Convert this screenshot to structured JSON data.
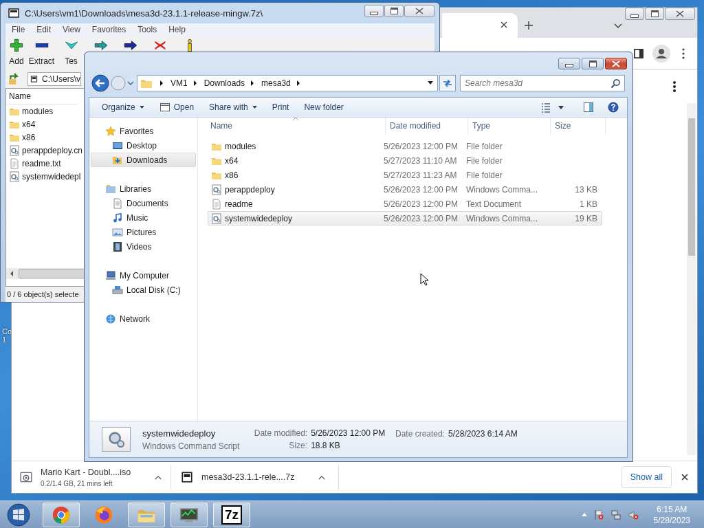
{
  "desktop": {
    "icon_label_lines": [
      "Co",
      "1"
    ]
  },
  "archive_window": {
    "title": "C:\\Users\\vm1\\Downloads\\mesa3d-23.1.1-release-mingw.7z\\",
    "menu": [
      "File",
      "Edit",
      "View",
      "Favorites",
      "Tools",
      "Help"
    ],
    "toolbar": [
      {
        "kind": "add",
        "label": "Add"
      },
      {
        "kind": "extract",
        "label": "Extract"
      },
      {
        "kind": "test",
        "label": "Tes"
      },
      {
        "kind": "copy"
      },
      {
        "kind": "move"
      },
      {
        "kind": "delete"
      },
      {
        "kind": "info"
      }
    ],
    "address": "C:\\Users\\v",
    "column": "Name",
    "files": [
      {
        "name": "modules",
        "kind": "folder"
      },
      {
        "name": "x64",
        "kind": "folder"
      },
      {
        "name": "x86",
        "kind": "folder"
      },
      {
        "name": "perappdeploy.cn",
        "kind": "script"
      },
      {
        "name": "readme.txt",
        "kind": "text"
      },
      {
        "name": "systemwidedepl",
        "kind": "script"
      }
    ],
    "status": "0 / 6 object(s) selecte"
  },
  "browser": {
    "downloads": [
      {
        "kind": "iso",
        "name": "Mario Kart - Doubl....iso",
        "detail": "0.2/1.4 GB, 21 mins left"
      },
      {
        "kind": "archive",
        "name": "mesa3d-23.1.1-rele....7z"
      }
    ],
    "show_all": "Show all"
  },
  "explorer": {
    "breadcrumbs": [
      "VM1",
      "Downloads",
      "mesa3d"
    ],
    "search": {
      "placeholder": "Search mesa3d"
    },
    "commands": [
      {
        "kind": "menu",
        "label": "Organize"
      },
      {
        "kind": "open",
        "label": "Open"
      },
      {
        "kind": "menu",
        "label": "Share with"
      },
      {
        "kind": "plain",
        "label": "Print"
      },
      {
        "kind": "plain",
        "label": "New folder"
      }
    ],
    "nav": [
      {
        "label": "Favorites",
        "kind": "star",
        "selected": false,
        "children": [
          {
            "label": "Desktop",
            "kind": "desktop",
            "selected": false
          },
          {
            "label": "Downloads",
            "kind": "downloads",
            "selected": true
          }
        ]
      },
      {
        "label": "Libraries",
        "kind": "library",
        "selected": false,
        "children": [
          {
            "label": "Documents",
            "kind": "document",
            "selected": false
          },
          {
            "label": "Music",
            "kind": "music",
            "selected": false
          },
          {
            "label": "Pictures",
            "kind": "pictures",
            "selected": false
          },
          {
            "label": "Videos",
            "kind": "videos",
            "selected": false
          }
        ]
      },
      {
        "label": "My Computer",
        "kind": "computer",
        "selected": false,
        "children": [
          {
            "label": "Local Disk (C:)",
            "kind": "disk",
            "selected": false
          }
        ]
      },
      {
        "label": "Network",
        "kind": "network",
        "selected": false
      }
    ],
    "columns": [
      "Name",
      "Date modified",
      "Type",
      "Size"
    ],
    "rows": [
      {
        "name": "modules",
        "kind": "folder",
        "date": "5/26/2023 12:00 PM",
        "type": "File folder",
        "selected": false
      },
      {
        "name": "x64",
        "kind": "folder",
        "date": "5/27/2023 11:10 AM",
        "type": "File folder",
        "selected": false
      },
      {
        "name": "x86",
        "kind": "folder",
        "date": "5/27/2023 11:23 AM",
        "type": "File folder",
        "selected": false
      },
      {
        "name": "perappdeploy",
        "kind": "script",
        "date": "5/26/2023 12:00 PM",
        "type": "Windows Comma...",
        "size": "13 KB",
        "selected": false
      },
      {
        "name": "readme",
        "kind": "text",
        "date": "5/26/2023 12:00 PM",
        "type": "Text Document",
        "size": "1 KB",
        "selected": false
      },
      {
        "name": "systemwidedeploy",
        "kind": "script",
        "date": "5/26/2023 12:00 PM",
        "type": "Windows Comma...",
        "size": "19 KB",
        "selected": true
      }
    ],
    "details": {
      "name": "systemwidedeploy",
      "type": "Windows Command Script",
      "modified_label": "Date modified:",
      "modified": "5/26/2023 12:00 PM",
      "size_label": "Size:",
      "size": "18.8 KB",
      "created_label": "Date created:",
      "created": "5/28/2023 6:14 AM"
    }
  },
  "taskbar": {
    "apps": [
      {
        "kind": "chrome",
        "running": true
      },
      {
        "kind": "firefox",
        "running": false
      },
      {
        "kind": "explorer",
        "running": true
      },
      {
        "kind": "monitor",
        "running": true
      },
      {
        "kind": "sevenzip",
        "running": true,
        "logo_text": "7z"
      }
    ],
    "time": "6:15 AM",
    "date": "5/28/2023"
  }
}
